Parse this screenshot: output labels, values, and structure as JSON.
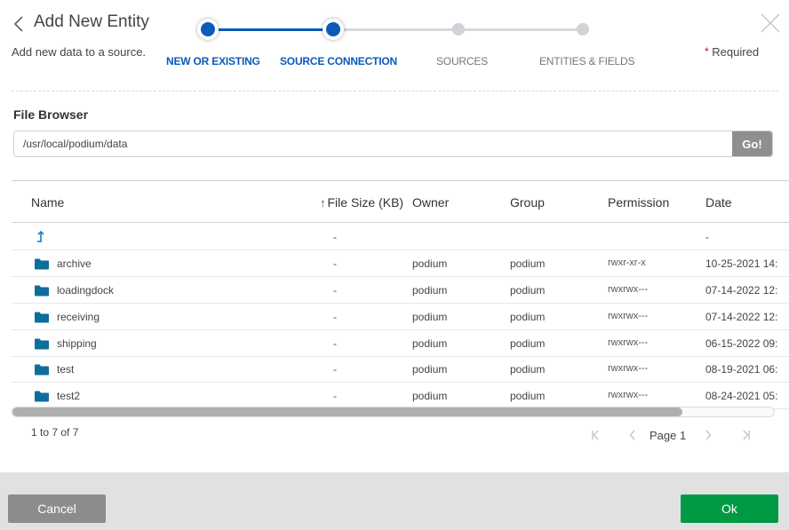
{
  "header": {
    "back_icon": "chevron-left-icon",
    "title": "Add New Entity",
    "subtitle": "Add new data to a source.",
    "close_icon": "close-icon",
    "required_star": "*",
    "required_label": "Required"
  },
  "stepper": {
    "steps": [
      {
        "label": "NEW OR EXISTING",
        "state": "completed"
      },
      {
        "label": "SOURCE CONNECTION",
        "state": "current"
      },
      {
        "label": "SOURCES",
        "state": "pending"
      },
      {
        "label": "ENTITIES & FIELDS",
        "state": "pending"
      }
    ],
    "active_color": "#0b5ab8",
    "inactive_color": "#d0d3d7"
  },
  "file_browser": {
    "label": "File Browser",
    "path_value": "/usr/local/podium/data",
    "go_label": "Go!"
  },
  "grid": {
    "columns": [
      {
        "key": "name",
        "label": "Name"
      },
      {
        "key": "size",
        "label": "File Size (KB)",
        "sort": "ascending"
      },
      {
        "key": "owner",
        "label": "Owner"
      },
      {
        "key": "group",
        "label": "Group"
      },
      {
        "key": "permission",
        "label": "Permission"
      },
      {
        "key": "date",
        "label": "Date"
      }
    ],
    "parent_row": {
      "icon": "up-arrow-icon",
      "size": "-",
      "date": "-"
    },
    "rows": [
      {
        "icon": "folder-icon",
        "name": "archive",
        "size": "-",
        "owner": "podium",
        "group": "podium",
        "permission": "rwxr-xr-x",
        "date": "10-25-2021 14:"
      },
      {
        "icon": "folder-icon",
        "name": "loadingdock",
        "size": "-",
        "owner": "podium",
        "group": "podium",
        "permission": "rwxrwx---",
        "date": "07-14-2022 12:"
      },
      {
        "icon": "folder-icon",
        "name": "receiving",
        "size": "-",
        "owner": "podium",
        "group": "podium",
        "permission": "rwxrwx---",
        "date": "07-14-2022 12:"
      },
      {
        "icon": "folder-icon",
        "name": "shipping",
        "size": "-",
        "owner": "podium",
        "group": "podium",
        "permission": "rwxrwx---",
        "date": "06-15-2022 09:"
      },
      {
        "icon": "folder-icon",
        "name": "test",
        "size": "-",
        "owner": "podium",
        "group": "podium",
        "permission": "rwxrwx---",
        "date": "08-19-2021 06:"
      },
      {
        "icon": "folder-icon",
        "name": "test2",
        "size": "-",
        "owner": "podium",
        "group": "podium",
        "permission": "rwxrwx---",
        "date": "08-24-2021 05:"
      }
    ],
    "folder_color": "#0d6e9c",
    "horizontal_scroll_visible_fraction": 0.88
  },
  "pagination": {
    "summary": "1 to 7 of 7",
    "page_label": "Page",
    "page_number": "1",
    "first_icon": "first-page-icon",
    "prev_icon": "chevron-left-icon",
    "next_icon": "chevron-right-icon",
    "last_icon": "last-page-icon"
  },
  "footer": {
    "cancel_label": "Cancel",
    "ok_label": "Ok",
    "ok_color": "#009a44"
  }
}
